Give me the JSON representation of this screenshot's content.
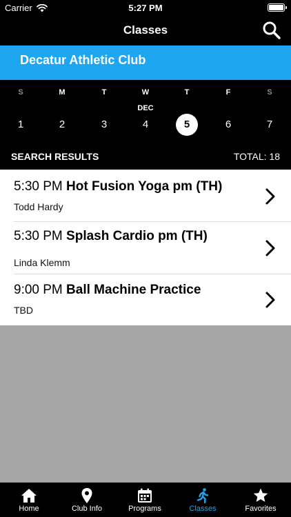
{
  "status": {
    "carrier": "Carrier",
    "time": "5:27 PM"
  },
  "nav": {
    "title": "Classes"
  },
  "club": {
    "name": "Decatur Athletic Club"
  },
  "calendar": {
    "month": "DEC",
    "weekdays": [
      "S",
      "M",
      "T",
      "W",
      "T",
      "F",
      "S"
    ],
    "days": [
      "1",
      "2",
      "3",
      "4",
      "5",
      "6",
      "7"
    ],
    "selected_day": "5"
  },
  "results": {
    "label": "SEARCH RESULTS",
    "total": "TOTAL: 18"
  },
  "classes": [
    {
      "time": "5:30 PM",
      "name": "Hot Fusion Yoga pm (TH)",
      "instructor": "Todd Hardy"
    },
    {
      "time": "5:30 PM",
      "name": "Splash Cardio pm (TH)",
      "instructor": "Linda Klemm"
    },
    {
      "time": "9:00 PM",
      "name": "Ball Machine Practice",
      "instructor": "TBD"
    }
  ],
  "tabs": [
    {
      "label": "Home",
      "icon": "home-icon"
    },
    {
      "label": "Club Info",
      "icon": "location-pin-icon"
    },
    {
      "label": "Programs",
      "icon": "calendar-icon"
    },
    {
      "label": "Classes",
      "icon": "runner-icon",
      "active": true
    },
    {
      "label": "Favorites",
      "icon": "star-icon"
    }
  ],
  "colors": {
    "accent": "#1ea7f0",
    "empty_area": "#a6a6a6"
  }
}
